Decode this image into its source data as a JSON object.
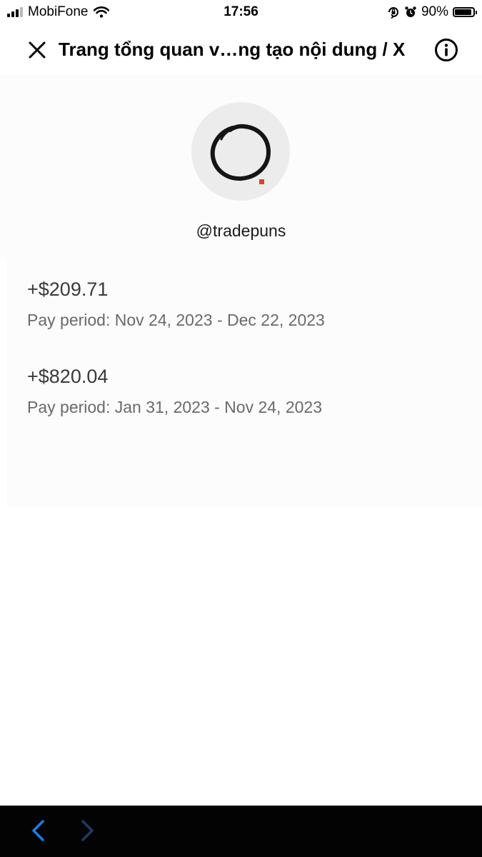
{
  "status_bar": {
    "carrier": "MobiFone",
    "time": "17:56",
    "battery_percent": "90%",
    "battery_level": 0.9,
    "icons": [
      "signal-icon",
      "wifi-icon",
      "orientation-lock-icon",
      "alarm-icon",
      "battery-icon"
    ]
  },
  "header": {
    "title": "Trang tổng quan v…ng tạo nội dung / X",
    "close_icon": "close-icon",
    "info_icon": "info-icon"
  },
  "profile": {
    "handle": "@tradepuns",
    "avatar_icon": "enso-circle-avatar"
  },
  "payments": [
    {
      "amount": "+$209.71",
      "period": "Pay period: Nov 24, 2023 - Dec 22, 2023"
    },
    {
      "amount": "+$820.04",
      "period": "Pay period: Jan 31, 2023 - Nov 24, 2023"
    }
  ],
  "bottom_bar": {
    "back_icon": "chevron-left-icon",
    "forward_icon": "chevron-right-icon",
    "colors": {
      "background": "#030303",
      "back_active": "#1d7ce8",
      "forward_disabled": "#1b3c66"
    }
  }
}
